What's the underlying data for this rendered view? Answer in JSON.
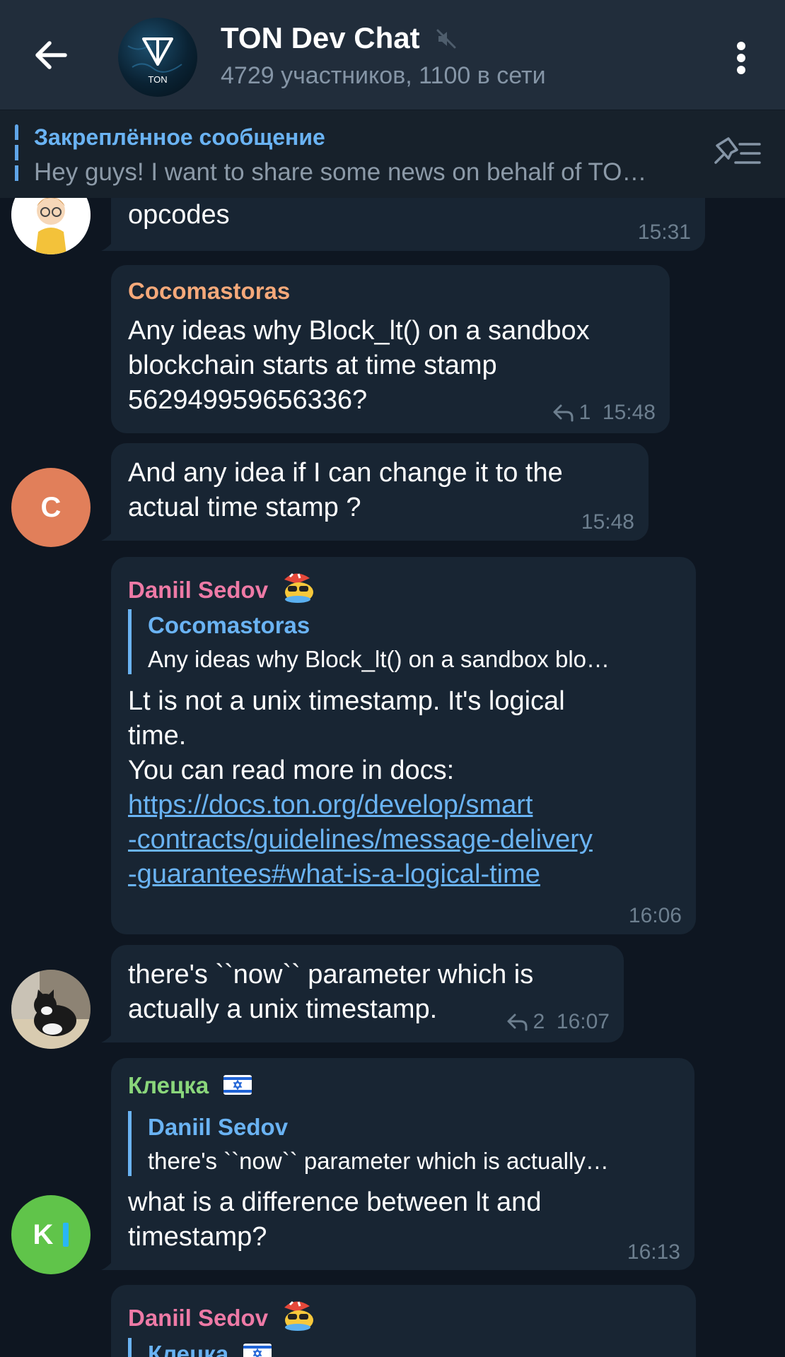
{
  "header": {
    "title": "TON Dev Chat",
    "subtitle": "4729 участников, 1100 в сети",
    "avatar_text": "TON"
  },
  "pinned": {
    "title": "Закреплённое сообщение",
    "text": "Hey guys! I want to share some news on behalf of TO…"
  },
  "colors": {
    "background": "#0e1621",
    "bubble": "#182533",
    "accent": "#6ab3f3",
    "name_orange": "#f5a97a",
    "name_pink": "#ee7aa6",
    "name_green": "#8ad67b"
  },
  "messages": [
    {
      "id": "m1",
      "text": "opcodes",
      "time": "15:31"
    },
    {
      "id": "m2",
      "sender": "Cocomastoras",
      "lines": [
        "Any ideas why Block_lt() on a sandbox",
        "blockchain starts at time stamp",
        "562949959656336?"
      ],
      "replies": "1",
      "time": "15:48"
    },
    {
      "id": "m3",
      "lines": [
        "And any idea if I can change it to the",
        "actual time stamp ?"
      ],
      "time": "15:48",
      "avatar_letter": "C"
    },
    {
      "id": "m4",
      "sender": "Daniil Sedov",
      "quote_name": "Cocomastoras",
      "quote_text": "Any ideas why Block_lt() on a sandbox blo…",
      "lines": [
        "Lt is not a unix timestamp. It's logical",
        "time.",
        "You can read more in docs:"
      ],
      "link_lines": [
        "https://docs.ton.org/develop/smart",
        "-contracts/guidelines/message-delivery",
        "-guarantees#what-is-a-logical-time"
      ],
      "time": "16:06"
    },
    {
      "id": "m5",
      "lines": [
        "there's ``now`` parameter which is",
        "actually a unix timestamp."
      ],
      "replies": "2",
      "time": "16:07"
    },
    {
      "id": "m6",
      "sender": "Клецка",
      "quote_name": "Daniil Sedov",
      "quote_text": "there's ``now`` parameter which is actually…",
      "lines": [
        "what is a difference between lt and",
        "timestamp?"
      ],
      "time": "16:13",
      "avatar_letter": "K"
    },
    {
      "id": "m7",
      "sender": "Daniil Sedov",
      "quote_name": "Клецка"
    }
  ]
}
